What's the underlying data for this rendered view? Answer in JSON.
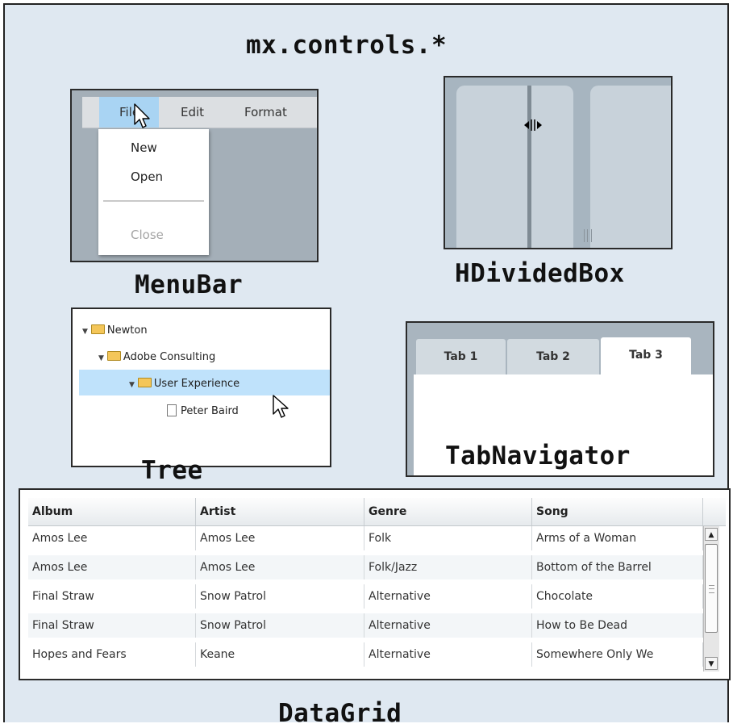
{
  "title": "mx.controls.*",
  "menubar": {
    "caption": "MenuBar",
    "menus": [
      "File",
      "Edit",
      "Format"
    ],
    "dropdown": [
      "New",
      "Open",
      "Close"
    ]
  },
  "hdividedbox": {
    "caption": "HDividedBox"
  },
  "tree": {
    "caption": "Tree",
    "nodes": [
      "Newton",
      "Adobe Consulting",
      "User Experience",
      "Peter Baird"
    ]
  },
  "tabnavigator": {
    "caption": "TabNavigator",
    "tabs": [
      "Tab 1",
      "Tab 2",
      "Tab 3"
    ],
    "selected": "Tab 3"
  },
  "datagrid": {
    "caption": "DataGrid",
    "columns": [
      "Album",
      "Artist",
      "Genre",
      "Song"
    ],
    "rows": [
      [
        "Amos Lee",
        "Amos Lee",
        "Folk",
        "Arms of a Woman"
      ],
      [
        "Amos Lee",
        "Amos Lee",
        "Folk/Jazz",
        "Bottom of the Barrel"
      ],
      [
        "Final Straw",
        "Snow Patrol",
        "Alternative",
        "Chocolate"
      ],
      [
        "Final Straw",
        "Snow Patrol",
        "Alternative",
        "How to Be Dead"
      ],
      [
        "Hopes and Fears",
        "Keane",
        "Alternative",
        "Somewhere Only We"
      ]
    ]
  }
}
